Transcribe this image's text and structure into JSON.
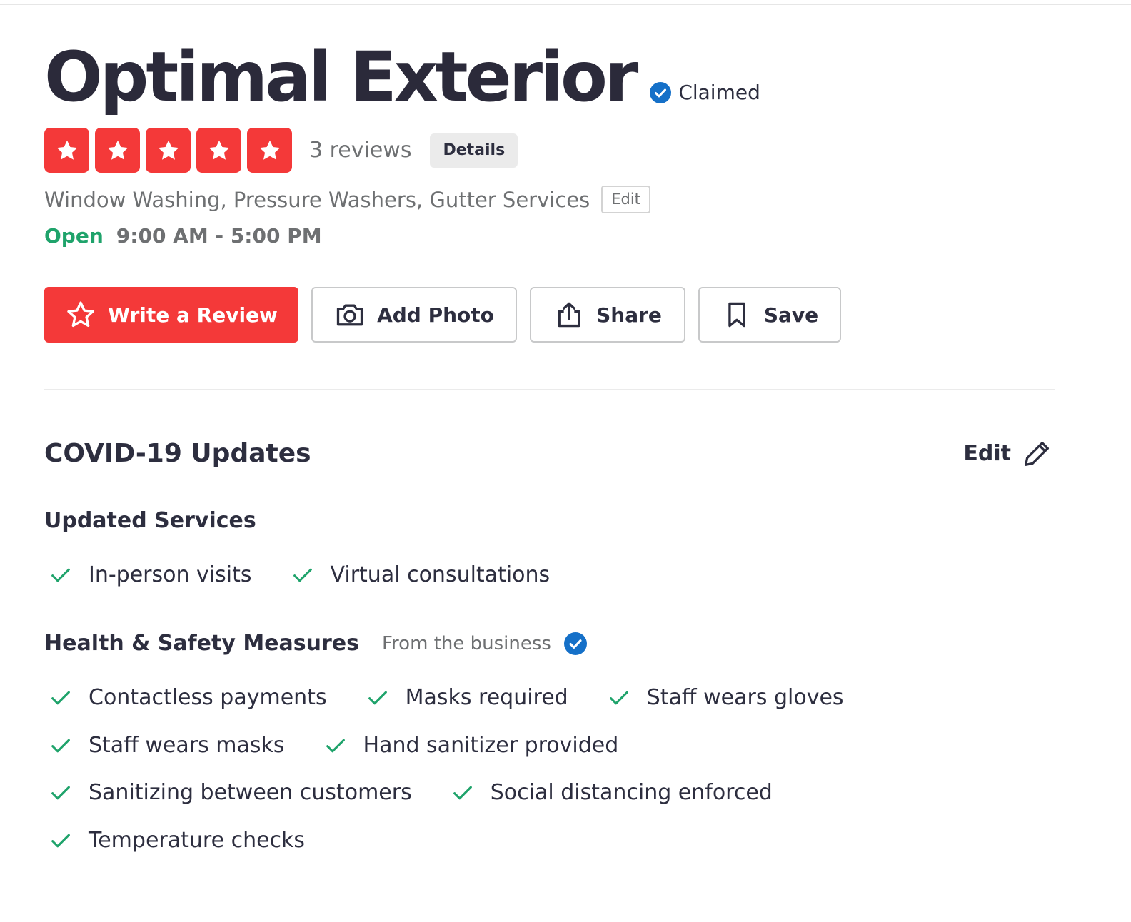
{
  "business": {
    "name": "Optimal Exterior",
    "claimed_label": "Claimed",
    "rating": 5,
    "rating_max": 5,
    "reviews_label": "3 reviews",
    "details_label": "Details",
    "categories": "Window Washing, Pressure Washers, Gutter Services",
    "categories_edit_label": "Edit",
    "open_status": "Open",
    "hours": "9:00 AM - 5:00 PM"
  },
  "actions": {
    "write_review": "Write a Review",
    "add_photo": "Add Photo",
    "share": "Share",
    "save": "Save"
  },
  "covid": {
    "title": "COVID-19 Updates",
    "edit_label": "Edit",
    "updated_services": {
      "heading": "Updated Services",
      "items": [
        "In-person visits",
        "Virtual consultations"
      ]
    },
    "health_safety": {
      "heading": "Health & Safety Measures",
      "source_label": "From the business",
      "rows": [
        [
          "Contactless payments",
          "Masks required",
          "Staff wears gloves"
        ],
        [
          "Staff wears masks",
          "Hand sanitizer provided"
        ],
        [
          "Sanitizing between customers",
          "Social distancing enforced"
        ],
        [
          "Temperature checks"
        ]
      ]
    }
  },
  "colors": {
    "brand_red": "#f43939",
    "open_green": "#1fa36b",
    "check_green": "#1fa36b",
    "verified_blue": "#1570c8",
    "text_dark": "#2d2e3f",
    "text_muted": "#6e7072"
  }
}
